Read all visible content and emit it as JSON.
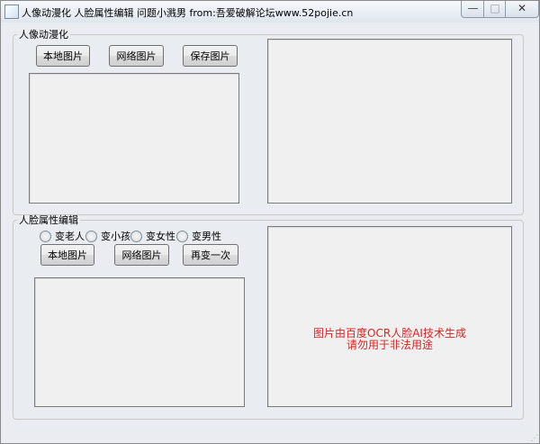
{
  "window": {
    "title": "人像动漫化 人脸属性编辑 问题小溅男 from:吾爱破解论坛www.52pojie.cn",
    "controls": {
      "minimize": "—",
      "maximize": "□",
      "close": "✕"
    }
  },
  "anime_group": {
    "title": "人像动漫化",
    "buttons": {
      "local": "本地图片",
      "network": "网络图片",
      "save": "保存图片"
    }
  },
  "face_group": {
    "title": "人脸属性编辑",
    "radios": [
      "变老人",
      "变小孩",
      "变女性",
      "变男性"
    ],
    "buttons": {
      "local": "本地图片",
      "network": "网络图片",
      "again": "再变一次"
    },
    "notice_line1": "图片由百度OCR人脸AI技术生成",
    "notice_line2": "请勿用于非法用途"
  }
}
